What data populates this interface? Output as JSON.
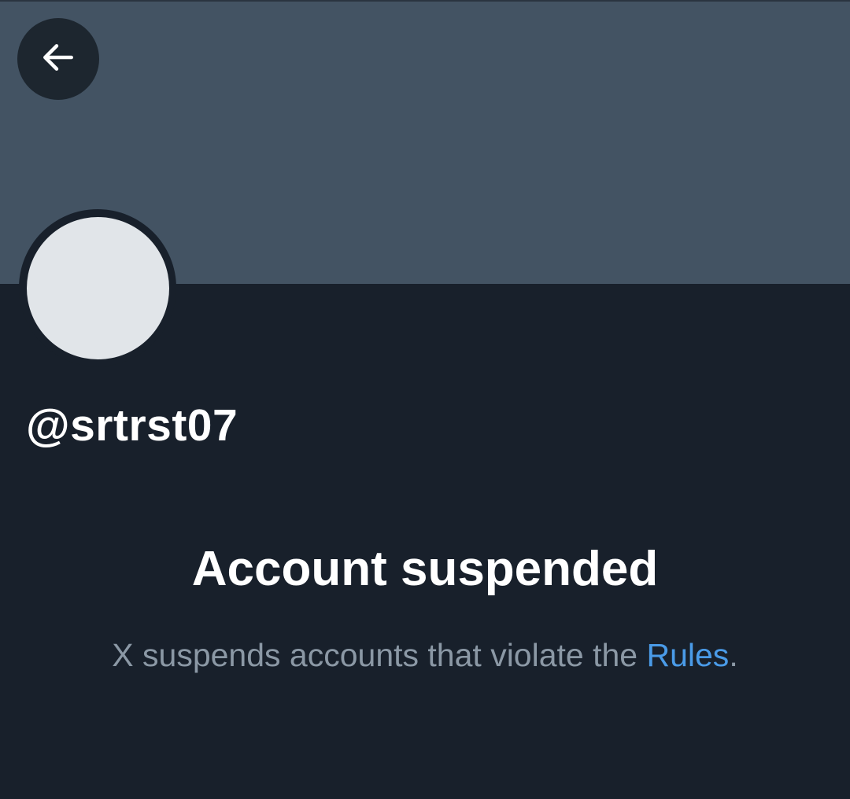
{
  "header": {
    "back_icon": "arrow-left-icon",
    "banner_color": "#435363"
  },
  "profile": {
    "handle": "@srtrst07",
    "avatar_color": "#e1e5e9"
  },
  "suspension": {
    "title": "Account suspended",
    "message_prefix": "X suspends accounts that violate the ",
    "rules_link": "Rules",
    "message_suffix": "."
  },
  "colors": {
    "background": "#18202b",
    "link": "#4a9be8",
    "muted_text": "#8b98a5"
  }
}
